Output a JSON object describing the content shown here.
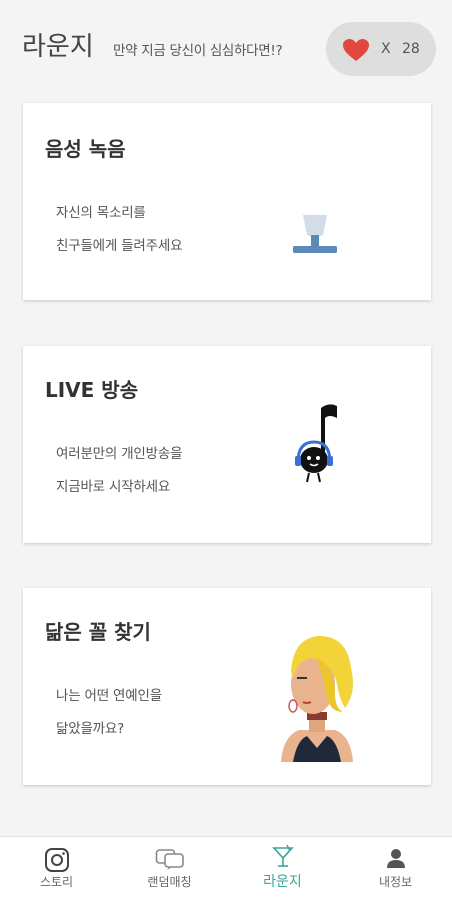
{
  "header": {
    "title": "라운지",
    "subtitle": "만약 지금 당신이 심심하다면!?",
    "heart_x": "X",
    "heart_count": "28",
    "heart_color": "#e2473d"
  },
  "cards": [
    {
      "title": "음성 녹음",
      "line1": "자신의 목소리를",
      "line2": "친구들에게 들려주세요",
      "icon": "microphone-icon"
    },
    {
      "title": "LIVE 방송",
      "line1": "여러분만의 개인방송을",
      "line2": "지금바로 시작하세요",
      "icon": "music-note-character-icon"
    },
    {
      "title": "닮은 꼴 찾기",
      "line1": "나는 어떤 연예인을",
      "line2": "닮았을까요?",
      "icon": "woman-illustration"
    }
  ],
  "nav": {
    "items": [
      {
        "label": "스토리",
        "icon": "instagram-icon"
      },
      {
        "label": "랜덤매칭",
        "icon": "chat-bubbles-icon"
      },
      {
        "label": "라운지",
        "icon": "cocktail-icon"
      },
      {
        "label": "내정보",
        "icon": "person-icon"
      }
    ],
    "active_color": "#3aa59a"
  }
}
